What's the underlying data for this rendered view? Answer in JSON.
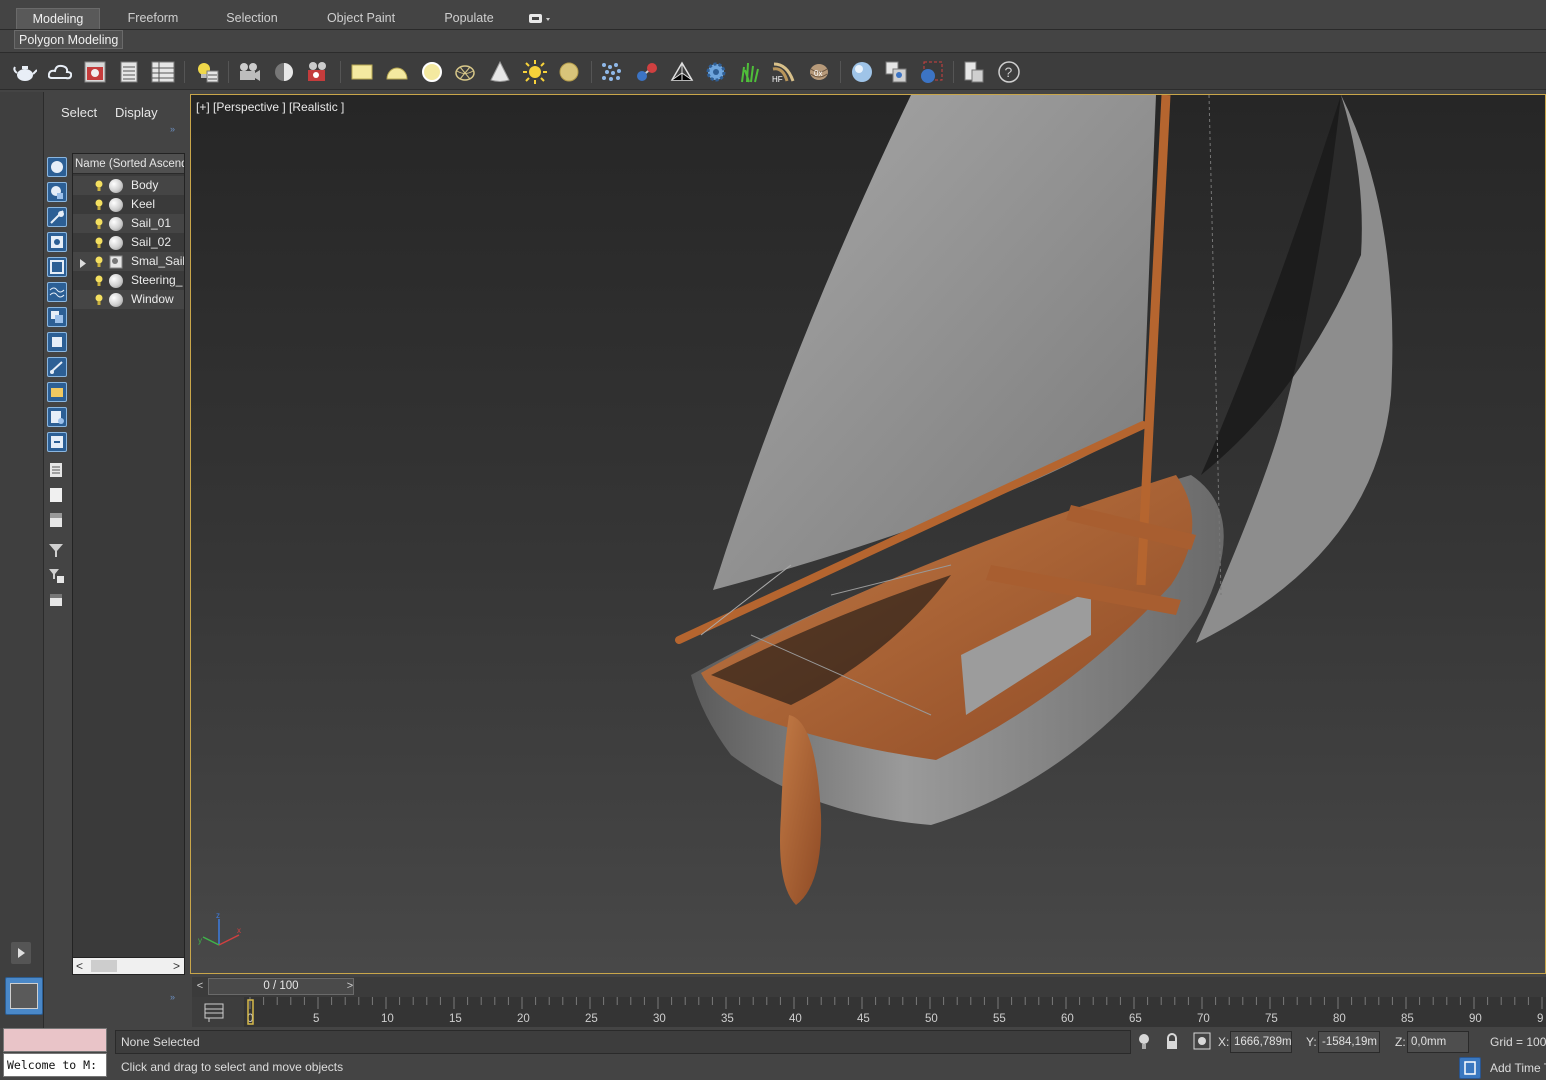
{
  "ribbon": {
    "tabs": [
      {
        "label": "Modeling"
      },
      {
        "label": "Freeform"
      },
      {
        "label": "Selection"
      },
      {
        "label": "Object Paint"
      },
      {
        "label": "Populate"
      }
    ],
    "active_panel": "Polygon Modeling"
  },
  "toolbar": {
    "icons": [
      "teapot-icon",
      "cloud-icon",
      "render-frame-icon",
      "material-editor-icon",
      "render-setup-icon",
      "light-lister-icon",
      "camera-icon",
      "half-sphere-icon",
      "render-icon",
      "plane-icon",
      "dome-icon",
      "sphere-icon",
      "teapot-wire-icon",
      "cone-icon",
      "sun-icon",
      "disc-icon",
      "particle-icon",
      "molecule-icon",
      "pyramid-icon",
      "gear-icon",
      "grass-icon",
      "hair-icon",
      "cloth-icon",
      "globe-icon",
      "snapshot-icon",
      "render-view-icon",
      "clipboard-icon",
      "help-icon"
    ]
  },
  "explorer": {
    "tabs": {
      "select": "Select",
      "display": "Display"
    },
    "column_header": "Name (Sorted Ascending)",
    "items": [
      {
        "label": "Body"
      },
      {
        "label": "Keel"
      },
      {
        "label": "Sail_01"
      },
      {
        "label": "Sail_02"
      },
      {
        "label": "Smal_Sail_"
      },
      {
        "label": "Steering_"
      },
      {
        "label": "Window"
      }
    ]
  },
  "viewport": {
    "label": "[+] [Perspective ] [Realistic ]",
    "colors": {
      "wood": "#a55a30",
      "sail": "#9a9a9a",
      "hull": "#8a8a8a"
    }
  },
  "timeline": {
    "frame_text": "0 / 100",
    "ticks": [
      "0",
      "5",
      "10",
      "15",
      "20",
      "25",
      "30",
      "35",
      "40",
      "45",
      "50",
      "55",
      "60",
      "65",
      "70",
      "75",
      "80",
      "85",
      "90",
      "9"
    ]
  },
  "status": {
    "maxscript_output": "Welcome to M:",
    "selection": "None Selected",
    "prompt": "Click and drag to select and move objects",
    "coords": {
      "x_label": "X:",
      "x": "1666,789m",
      "y_label": "Y:",
      "y": "-1584,19m",
      "z_label": "Z:",
      "z": "0,0mm"
    },
    "grid": "Grid = 100",
    "add_time_tag": "Add Time T"
  }
}
